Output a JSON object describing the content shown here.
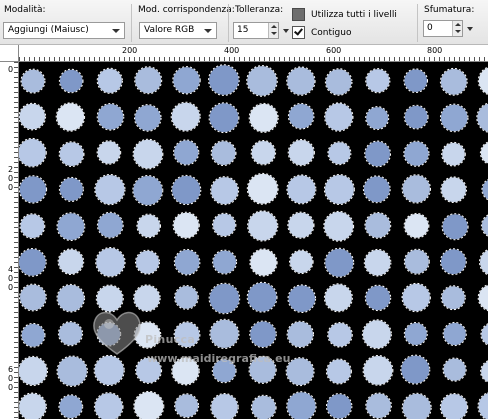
{
  "toolbar": {
    "mode_label": "Modalità:",
    "mode_value": "Aggiungi (Maiusc)",
    "match_label": "Mod. corrispondenza:",
    "match_value": "Valore RGB",
    "tolerance_label": "Tolleranza:",
    "tolerance_value": "15",
    "use_all_layers_label": "Utilizza tutti i livelli",
    "use_all_layers_checked": false,
    "contiguous_label": "Contiguo",
    "contiguous_checked": true,
    "feather_label": "Sfumatura:",
    "feather_value": "0"
  },
  "hruler": {
    "labels": [
      "200",
      "400",
      "600",
      "800"
    ]
  },
  "vruler": {
    "labels": [
      [
        "0"
      ],
      [
        "2",
        "0",
        "0"
      ],
      [
        "4",
        "0",
        "0"
      ],
      [
        "6",
        "0",
        "0"
      ]
    ]
  },
  "canvas": {
    "background": "#000000",
    "dot_colors": [
      "#c8d6ec",
      "#a9bcdd",
      "#8fa7d2",
      "#dbe5f3",
      "#b7c8e6",
      "#7f98c8"
    ],
    "selection_marquee": "dashed"
  },
  "watermark": {
    "line1": "Pinucca",
    "line2": "www.maidiregrafica.eu"
  }
}
